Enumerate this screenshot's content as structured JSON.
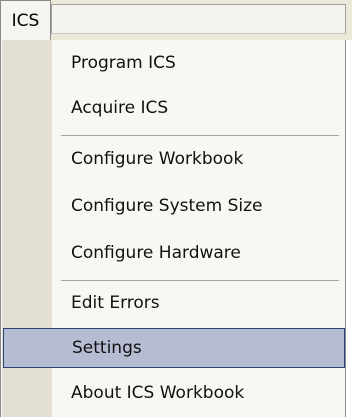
{
  "menubar": {
    "title": "ICS"
  },
  "menu": {
    "items": [
      {
        "label": "Program ICS"
      },
      {
        "label": "Acquire ICS"
      },
      {
        "label": "Configure Workbook"
      },
      {
        "label": "Configure System Size"
      },
      {
        "label": "Configure Hardware"
      },
      {
        "label": "Edit Errors"
      },
      {
        "label": "Settings",
        "selected": true
      },
      {
        "label": "About ICS Workbook"
      }
    ]
  }
}
